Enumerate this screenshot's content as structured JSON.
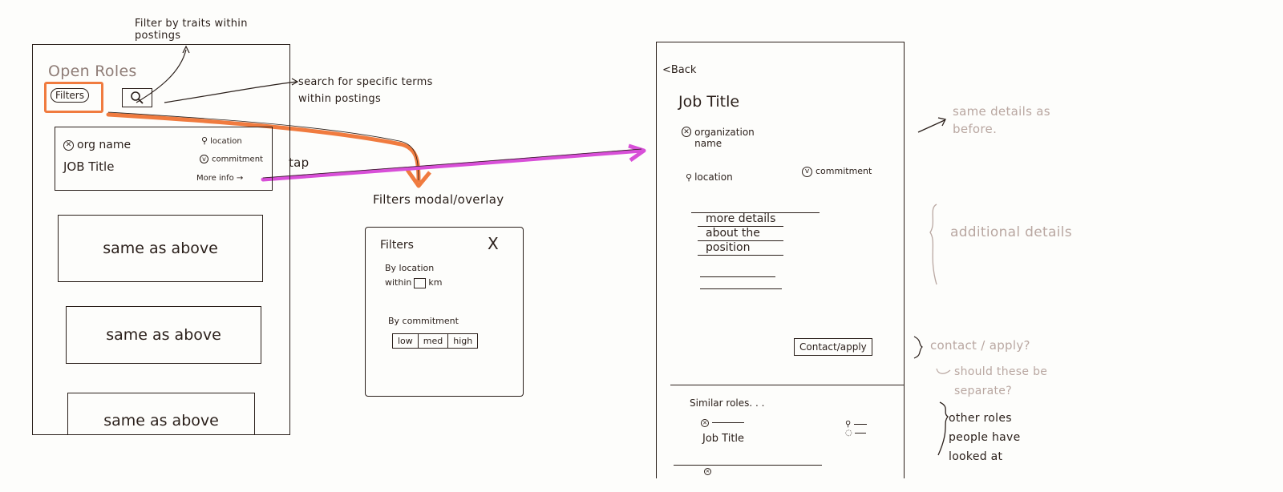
{
  "annotations": {
    "filter_note": "Filter by traits within postings",
    "search_note": "search for specific terms within postings",
    "tap_label": "tap",
    "modal_label": "Filters modal/overlay",
    "same_details_note": "same details as before.",
    "additional_details_note": "additional details",
    "contact_note": "contact / apply?",
    "separate_note": "should these be separate?",
    "other_roles_note": "other roles people have looked at"
  },
  "colors": {
    "ink": "#2a1f1a",
    "pencil": "#b9a7a1",
    "filters_arrow": "#f07b3f",
    "tap_arrow": "#d84fd8"
  },
  "list_screen": {
    "title": "Open Roles",
    "filters_label": "Filters",
    "search_icon": "search-icon",
    "first_card": {
      "org": "org name",
      "job_title": "JOB Title",
      "location": "location",
      "commitment": "commitment",
      "more_info": "More info →"
    },
    "repeat_cards": [
      "same as above",
      "same as above",
      "same as above"
    ]
  },
  "filters_modal": {
    "title": "Filters",
    "close": "X",
    "location_label": "By location",
    "within_label": "within",
    "km_label": "km",
    "commitment_label": "By commitment",
    "commitment_options": [
      "low",
      "med",
      "high"
    ]
  },
  "detail_screen": {
    "back": "<Back",
    "job_title": "Job Title",
    "org": "organization name",
    "location": "location",
    "commitment": "commitment",
    "details_lines": [
      "more details",
      "about the",
      "position"
    ],
    "apply_button": "Contact/apply",
    "similar_title": "Similar roles. . .",
    "similar_job_title": "Job Title"
  }
}
